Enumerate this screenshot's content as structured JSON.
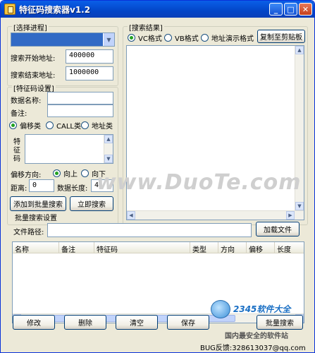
{
  "window": {
    "title": "特征码搜索器v1.2",
    "min_label": "_",
    "max_label": "□",
    "close_label": "✕"
  },
  "process_group": {
    "title": "[选择进程]",
    "start_label": "搜索开始地址:",
    "start_value": "400000",
    "end_label": "搜索结束地址:",
    "end_value": "1000000",
    "arrow": "▼"
  },
  "feature_group": {
    "title": "[特征码设置]",
    "name_label": "数据名称:",
    "note_label": "备注:",
    "types": [
      "偏移类",
      "CALL类",
      "地址类"
    ],
    "feature_label": "特征码",
    "direction_label": "偏移方向:",
    "directions": [
      "向上",
      "向下"
    ],
    "distance_label": "距离:",
    "distance_value": "0",
    "length_label": "数据长度:",
    "length_value": "4",
    "add_batch_button": "添加到批量搜索",
    "search_now_button": "立即搜索"
  },
  "results_group": {
    "title": "[搜索结果]",
    "formats": [
      "VC格式",
      "VB格式",
      "地址演示格式"
    ],
    "copy_button": "复制至剪贴板"
  },
  "batch_group": {
    "title": "批量搜索设置",
    "path_label": "文件路径:",
    "path_value": "",
    "load_button": "加载文件",
    "columns": [
      "名称",
      "备注",
      "特征码",
      "类型",
      "方向",
      "偏移",
      "长度"
    ]
  },
  "bottom_buttons": {
    "edit": "修改",
    "delete": "删除",
    "clear": "清空",
    "save": "保存",
    "batch_search": "批量搜索"
  },
  "watermark": "www.DuoTe.com",
  "brand": {
    "name": "2345软件大全",
    "slogan": "国内最安全的软件站"
  },
  "bug_report": "BUG反馈:328613037@qq.com"
}
